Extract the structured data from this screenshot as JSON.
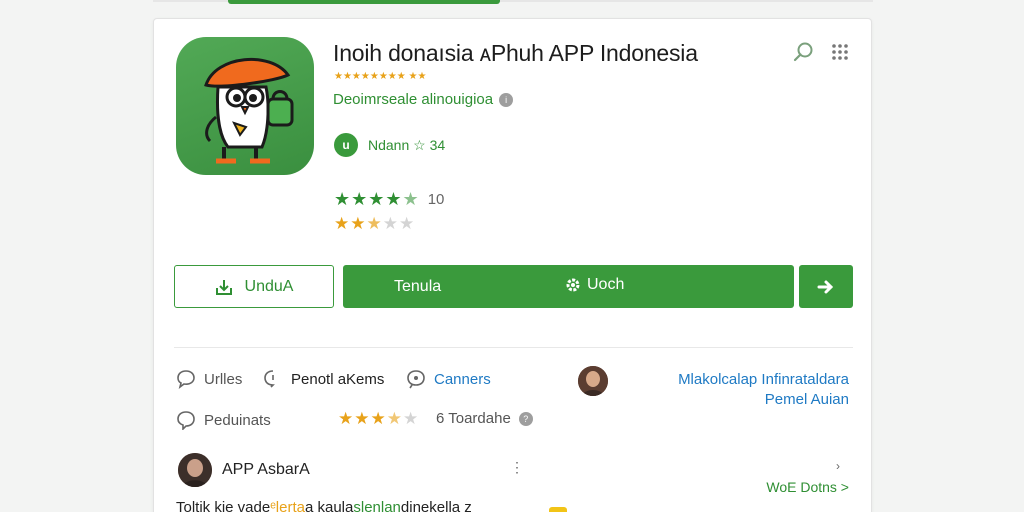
{
  "app": {
    "title": "Inoih donaısia ᴀPhuh APP Indonesia",
    "title_rating_text": "★★★★★★★★ ★★",
    "developer": "Deoimrseale alinouigioa",
    "info_badge": "i",
    "badge_label": "Ndann ☆ 34",
    "badge_initial": "u",
    "rating_value": "10",
    "stars_green": 4.5,
    "stars_yellow": 2.5
  },
  "actions": {
    "download_label": "UnduA",
    "install_label": "Tenula",
    "secondary_label": "Uoch"
  },
  "meta": {
    "item1": "Urlles",
    "item2": "Penotl aKems",
    "item3": "Canners",
    "link1_line1": "Mlakolcalap Infinrataldara",
    "link1_line2": "Pemel Auian"
  },
  "review": {
    "label": "Peduinats",
    "rating": 3.5,
    "count_text": "6  Toardahe",
    "info_badge": "?"
  },
  "comment": {
    "author": "APP AsbarA",
    "more_link": "WoE Dotns >",
    "text_before": "Toltik kie vade",
    "text_mid": "ᵉlerta",
    "text_after": "a kaula",
    "text_green": "slenlan",
    "text_end": "dinekella  z"
  },
  "colors": {
    "primary": "#3a9a3c",
    "link": "#1f7ac4",
    "star": "#e8a21a"
  },
  "icons": [
    "search-icon",
    "more-grid-icon",
    "download-icon",
    "gear-icon",
    "arrow-icon",
    "chat-icon",
    "star-icon"
  ]
}
